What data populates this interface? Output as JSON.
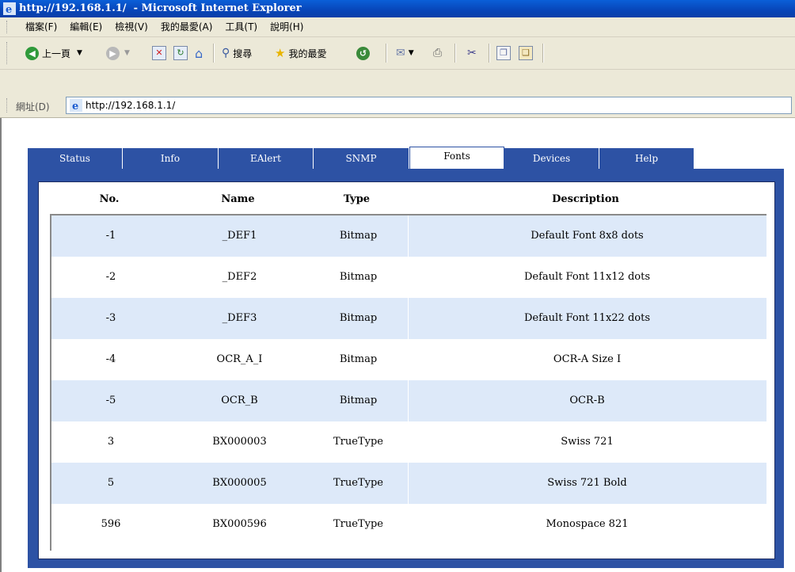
{
  "window": {
    "title": "http://192.168.1.1/  - Microsoft Internet Explorer"
  },
  "menubar": [
    "檔案(F)",
    "編輯(E)",
    "檢視(V)",
    "我的最愛(A)",
    "工具(T)",
    "說明(H)"
  ],
  "toolbar": {
    "back_label": "上一頁",
    "search_label": "搜尋",
    "favorites_label": "我的最愛"
  },
  "address": {
    "label": "網址(D)",
    "url": "http://192.168.1.1/"
  },
  "tabs": [
    "Status",
    "Info",
    "EAlert",
    "SNMP",
    "Fonts",
    "Devices",
    "Help"
  ],
  "active_tab": "Fonts",
  "table": {
    "headers": [
      "No.",
      "Name",
      "Type",
      "Description"
    ],
    "rows": [
      [
        "-1",
        "_DEF1",
        "Bitmap",
        "Default Font 8x8 dots"
      ],
      [
        "-2",
        "_DEF2",
        "Bitmap",
        "Default Font 11x12 dots"
      ],
      [
        "-3",
        "_DEF3",
        "Bitmap",
        "Default Font 11x22 dots"
      ],
      [
        "-4",
        "OCR_A_I",
        "Bitmap",
        "OCR-A Size I"
      ],
      [
        "-5",
        "OCR_B",
        "Bitmap",
        "OCR-B"
      ],
      [
        "3",
        "BX000003",
        "TrueType",
        "Swiss 721"
      ],
      [
        "5",
        "BX000005",
        "TrueType",
        "Swiss 721 Bold"
      ],
      [
        "596",
        "BX000596",
        "TrueType",
        "Monospace 821"
      ]
    ]
  },
  "colors": {
    "tab_blue": "#2d52a4",
    "row_alt": "#dde9f9",
    "chrome": "#ece9d8",
    "titlebar": "#0a5fd8"
  }
}
